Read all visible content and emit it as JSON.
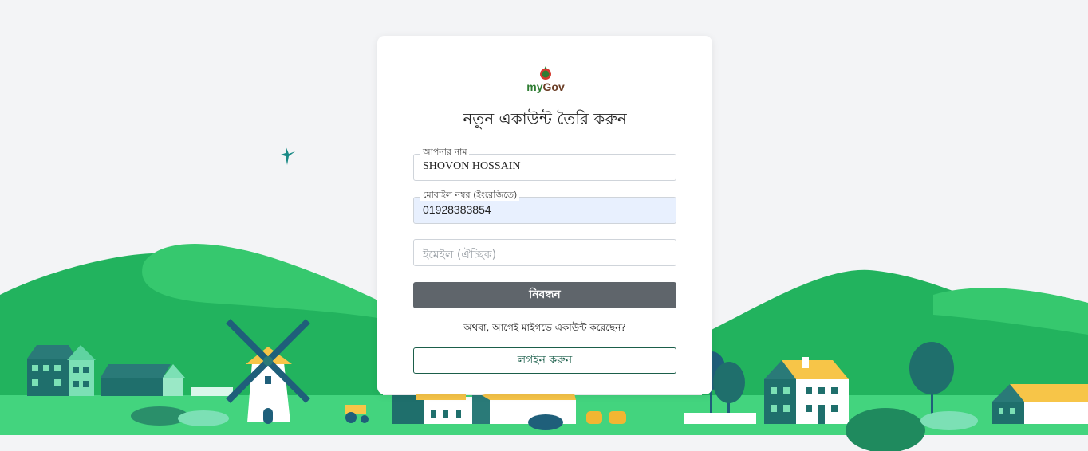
{
  "brand": {
    "logo_text_my": "my",
    "logo_text_gov": "Gov"
  },
  "form": {
    "title": "নতুন একাউন্ট তৈরি করুন",
    "name_label": "আপনার নাম",
    "name_value": "SHOVON HOSSAIN",
    "mobile_label": "মোবাইল নম্বর (ইংরেজিতে)",
    "mobile_value": "01928383854",
    "email_placeholder": "ইমেইল (ঐচ্ছিক)",
    "register_label": "নিবন্ধন",
    "or_text": "অথবা, আগেই মাইগভে একাউন্ট করেছেন?",
    "login_label": "লগইন করুন"
  },
  "colors": {
    "hill_light": "#36c86e",
    "hill_dark": "#1faa59",
    "ground": "#43d47e",
    "house_teal": "#2a7a78",
    "roof_yellow": "#f7c548",
    "button_gray": "#5f656b",
    "outline_green": "#1b5e4a"
  }
}
